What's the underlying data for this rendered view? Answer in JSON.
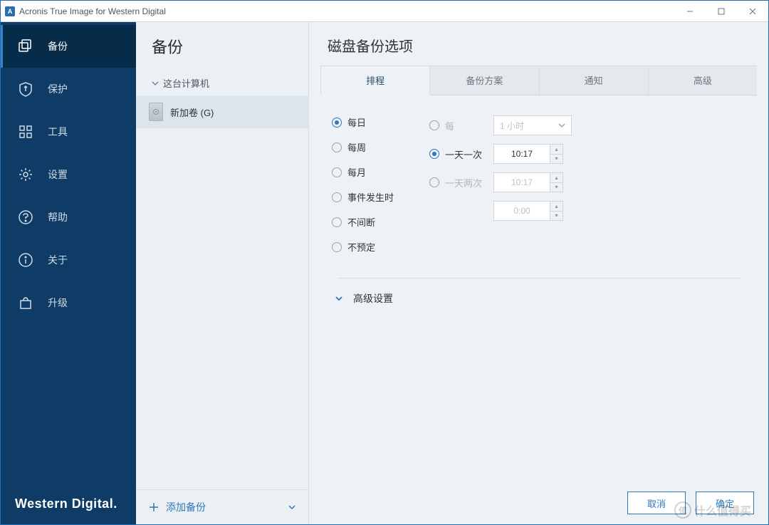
{
  "titlebar": {
    "app_icon_letter": "A",
    "title": "Acronis True Image for Western Digital"
  },
  "sidebar": {
    "items": [
      {
        "label": "备份"
      },
      {
        "label": "保护"
      },
      {
        "label": "工具"
      },
      {
        "label": "设置"
      },
      {
        "label": "帮助"
      },
      {
        "label": "关于"
      },
      {
        "label": "升级"
      }
    ],
    "brand": "Western Digital."
  },
  "second_col": {
    "header": "备份",
    "tree_root": "这台计算机",
    "tree_item": "新加卷 (G)",
    "add_backup": "添加备份"
  },
  "content": {
    "title": "磁盘备份选项",
    "tabs": [
      "排程",
      "备份方案",
      "通知",
      "高级"
    ],
    "frequency": [
      "每日",
      "每周",
      "每月",
      "事件发生时",
      "不间断",
      "不预定"
    ],
    "sub": {
      "every": "每",
      "interval": "1 小时",
      "once_a_day": "一天一次",
      "once_time": "10:17",
      "twice_a_day": "一天两次",
      "twice_time1": "10:17",
      "twice_time2": "0:00"
    },
    "advanced": "高级设置",
    "buttons": {
      "cancel": "取消",
      "ok": "确定"
    }
  },
  "watermark": {
    "icon": "值",
    "text": "什么值得买"
  }
}
